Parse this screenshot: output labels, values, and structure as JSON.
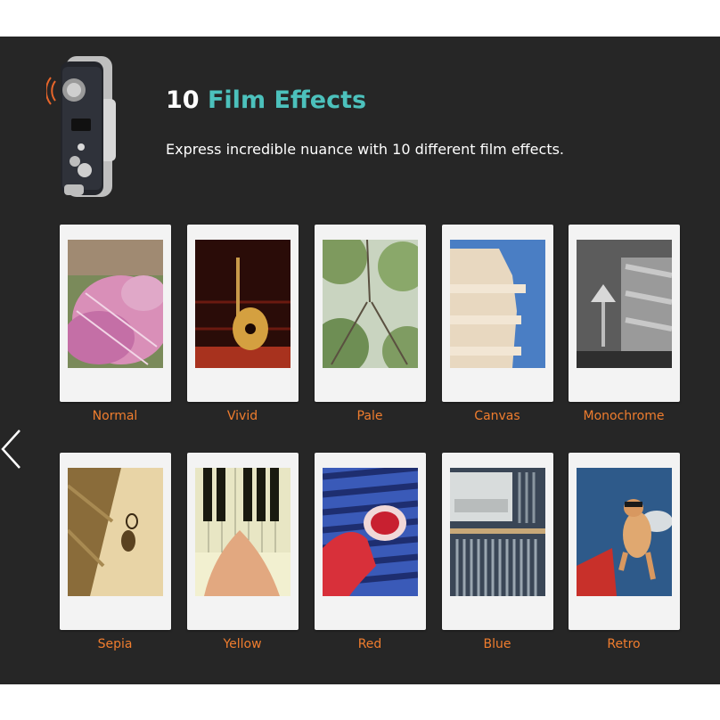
{
  "header": {
    "title_number": "10",
    "title_text": "Film Effects",
    "subtitle": "Express incredible nuance with 10 different film effects."
  },
  "effects": [
    {
      "label": "Normal"
    },
    {
      "label": "Vivid"
    },
    {
      "label": "Pale"
    },
    {
      "label": "Canvas"
    },
    {
      "label": "Monochrome"
    },
    {
      "label": "Sepia"
    },
    {
      "label": "Yellow"
    },
    {
      "label": "Red"
    },
    {
      "label": "Blue"
    },
    {
      "label": "Retro"
    }
  ],
  "colors": {
    "panel_bg": "#262626",
    "accent_title": "#4cc1bc",
    "label": "#f07d2e"
  },
  "nav": {
    "prev_icon": "chevron-left-icon"
  }
}
